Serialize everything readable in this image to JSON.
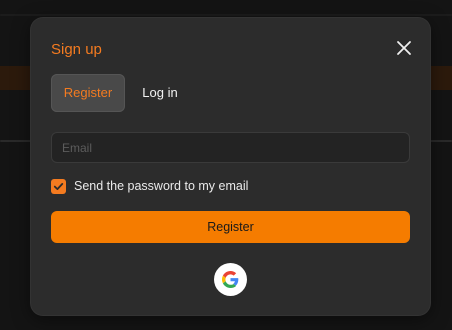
{
  "colors": {
    "accent": "#f47b20",
    "button": "#f57c00",
    "modal_bg": "#2c2c2c"
  },
  "modal": {
    "title": "Sign up",
    "close_icon": "close-icon",
    "tabs": [
      {
        "label": "Register",
        "active": true
      },
      {
        "label": "Log in",
        "active": false
      }
    ],
    "email": {
      "placeholder": "Email",
      "value": ""
    },
    "checkbox": {
      "label": "Send the password to my email",
      "checked": true
    },
    "submit_label": "Register",
    "social": {
      "icon": "google-icon"
    }
  }
}
